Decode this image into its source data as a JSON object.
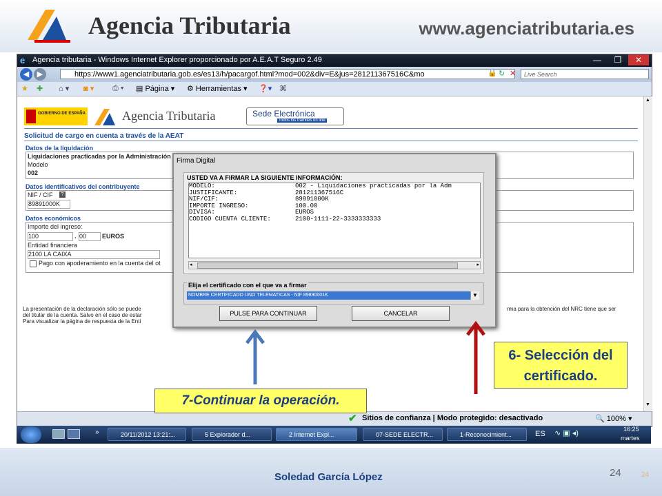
{
  "header": {
    "title": "Agencia Tributaria",
    "website": "www.agenciatributaria.es"
  },
  "browser": {
    "window_title": "Agencia tributaria - Windows Internet Explorer proporcionado por A.E.A.T Seguro 2.49",
    "url": "https://www1.agenciatributaria.gob.es/es13/h/pacargof.html?mod=002&div=E&jus=281211367516C&mo",
    "search_placeholder": "Live Search",
    "toolbar": {
      "page_label": "Página",
      "tools_label": "Herramientas"
    },
    "status": "Sitios de confianza | Modo protegido: desactivado",
    "zoom": "100%"
  },
  "page": {
    "logo_gov": "GOBIERNO DE ESPAÑA",
    "logo_title": "Agencia Tributaria",
    "sede_title": "Sede Electrónica",
    "sede_subtitle": "Todos los trámites on line",
    "heading": "Solicitud de cargo en cuenta a través de la AEAT",
    "sec_liquidacion": "Datos de la liquidación",
    "liquidacion_value": "Liquidaciones practicadas por la Administración",
    "modelo_label": "Modelo",
    "modelo_value": "002",
    "sec_contribuyente": "Datos identificativos del contribuyente",
    "nif_label": "NIF / CIF",
    "nif_value": "89891000K",
    "sec_economicos": "Datos económicos",
    "importe_label": "Importe del ingreso:",
    "importe_entero": "100",
    "importe_decimal": "00",
    "currency": "EUROS",
    "entidad_label": "Entidad financiera",
    "entidad_value": "2100 LA CAIXA",
    "checkbox_label": "Pago con apoderamiento en la cuenta del ot",
    "footer_line1": "La presentación de la declaración sólo se puede",
    "footer_line1_right": "rma para la obtención del NRC tiene que ser",
    "footer_line2": "del titular de la cuenta. Salvo en el caso de estar",
    "footer_line3": "Para visualizar la página de respuesta de la Enti"
  },
  "dialog": {
    "title": "Firma Digital",
    "info_title": "USTED VA A FIRMAR LA SIGUIENTE INFORMACIÓN:",
    "rows": [
      {
        "key": "MODELO:",
        "value": "002 - Liquidaciones practicadas por la Adm"
      },
      {
        "key": "JUSTIFICANTE:",
        "value": "281211367516C"
      },
      {
        "key": "NIF/CIF:",
        "value": "89891000K"
      },
      {
        "key": "IMPORTE INGRESO:",
        "value": "100.00"
      },
      {
        "key": "DIVISA:",
        "value": "EUROS"
      },
      {
        "key": "CODIGO CUENTA CLIENTE:",
        "value": "2100-1111-22-3333333333"
      }
    ],
    "cert_title": "Elija el certificado con el que va a firmar",
    "cert_value": "NOMBRE CERTIFICADO UNO TELEMATICAS - NIF 89890001K",
    "continue_label": "PULSE PARA CONTINUAR",
    "cancel_label": "CANCELAR"
  },
  "callouts": {
    "step6": "6- Selección del certificado.",
    "step7": "7-Continuar la operación."
  },
  "arrow_colors": {
    "blue": "#4a78b8",
    "red": "#b01010"
  },
  "taskbar": {
    "items": [
      "20/11/2012 13:21:...",
      "5 Explorador d...",
      "2 Internet Expl...",
      "07-SEDE ELECTR...",
      "1-Reconocimient..."
    ],
    "lang": "ES",
    "time": "16:25",
    "day": "martes"
  },
  "footer": {
    "author": "Soledad García López",
    "page": "24",
    "page_small": "24"
  }
}
